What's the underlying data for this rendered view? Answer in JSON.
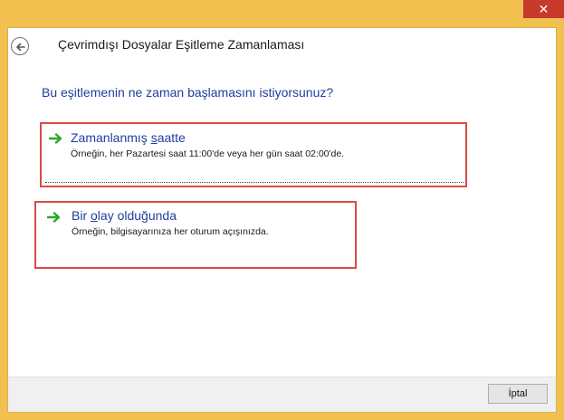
{
  "window": {
    "close_glyph": "✕"
  },
  "header": {
    "title": "Çevrimdışı Dosyalar Eşitleme Zamanlaması",
    "back_icon": "back-arrow-icon"
  },
  "question": "Bu eşitlemenin ne zaman başlamasını istiyorsunuz?",
  "options": [
    {
      "title_pre": "Zamanlanmış ",
      "title_ul": "s",
      "title_post": "aatte",
      "description": "Örneğin, her Pazartesi saat 11:00'de veya her gün saat 02:00'de.",
      "icon": "green-arrow-icon"
    },
    {
      "title_pre": "Bir ",
      "title_ul": "o",
      "title_post": "lay olduğunda",
      "description": "Örneğin, bilgisayarınıza her oturum açışınızda.",
      "icon": "green-arrow-icon"
    }
  ],
  "footer": {
    "cancel_label": "İptal"
  },
  "colors": {
    "frame": "#f2c04f",
    "close": "#c7392b",
    "link_blue": "#1e3f9e",
    "highlight_red": "#e04848",
    "arrow_green": "#2aa829"
  }
}
